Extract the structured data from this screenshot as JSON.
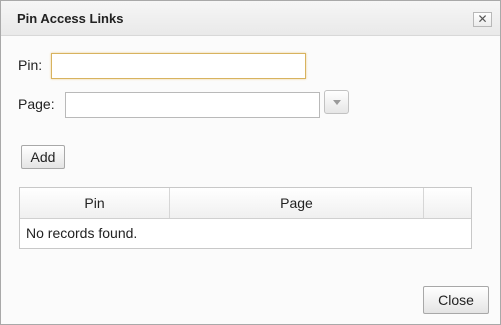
{
  "dialog": {
    "title": "Pin Access Links",
    "close_icon": "close-icon",
    "close_glyph": "✕"
  },
  "form": {
    "pin_label": "Pin:",
    "pin_value": "",
    "page_label": "Page:",
    "page_value": "",
    "dropdown_icon": "chevron-down-icon",
    "add_label": "Add"
  },
  "table": {
    "columns": [
      "Pin",
      "Page",
      ""
    ],
    "empty_message": "No records found."
  },
  "footer": {
    "close_label": "Close"
  },
  "colors": {
    "focus_border": "#d8b35f",
    "title_bg": "#ececec"
  }
}
